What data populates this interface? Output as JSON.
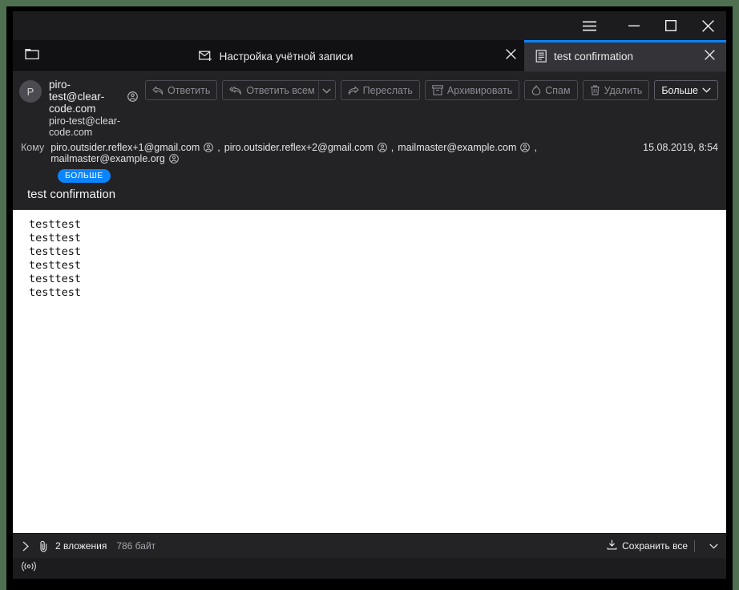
{
  "window": {
    "controls": {
      "menu": "menu-hamburger",
      "minimize": "minimize",
      "maximize": "maximize",
      "close": "close"
    }
  },
  "tabs": [
    {
      "icon": "folder-icon",
      "label": "",
      "active": false,
      "closable": false
    },
    {
      "icon": "mail-new-icon",
      "label": "Настройка учётной записи",
      "active": false,
      "closable": true
    },
    {
      "icon": "message-icon",
      "label": "test confirmation",
      "active": true,
      "closable": true
    }
  ],
  "message": {
    "avatar_initial": "P",
    "sender_name": "piro-test@clear-code.com",
    "sender_email": "piro-test@clear-code.com",
    "to_label": "Кому",
    "recipients": [
      "piro.outsider.reflex+1@gmail.com",
      "piro.outsider.reflex+2@gmail.com",
      "mailmaster@example.com",
      "mailmaster@example.org"
    ],
    "more_badge": "БОЛЬШЕ",
    "date": "15.08.2019, 8:54",
    "subject": "test confirmation",
    "body": "testtest\ntesttest\ntesttest\ntesttest\ntesttest\ntesttest"
  },
  "toolbar": {
    "reply": "Ответить",
    "reply_all": "Ответить всем",
    "forward": "Переслать",
    "archive": "Архивировать",
    "spam": "Спам",
    "delete": "Удалить",
    "more": "Больше"
  },
  "attachments": {
    "count_label": "2 вложения",
    "size_label": "786 байт",
    "save_all": "Сохранить все"
  },
  "colors": {
    "accent": "#0a84ff",
    "window_bg": "#1c1c1f",
    "header_bg": "#232326",
    "tabbar_bg": "#111113",
    "active_tab": "#333338",
    "desktop": "#4e7050"
  }
}
